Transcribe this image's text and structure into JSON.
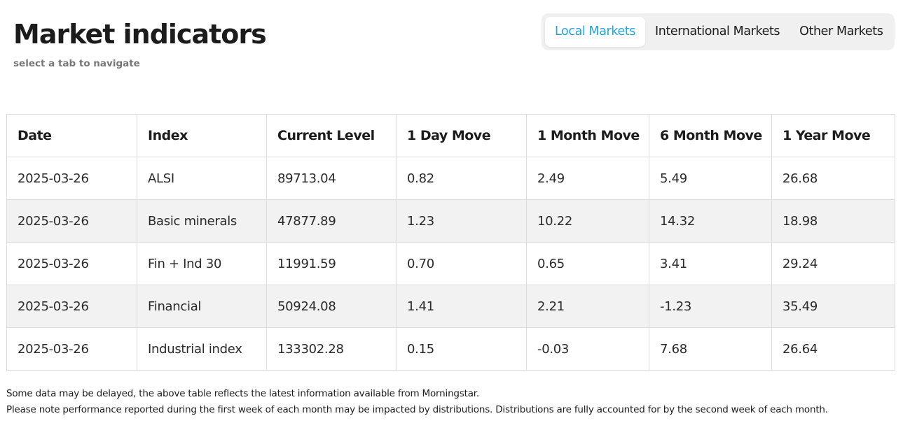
{
  "header": {
    "title": "Market indicators",
    "subtitle": "select a tab to navigate"
  },
  "tabs": [
    {
      "label": "Local Markets",
      "active": true
    },
    {
      "label": "International Markets",
      "active": false
    },
    {
      "label": "Other Markets",
      "active": false
    }
  ],
  "colors": {
    "accent": "#1ea5dc",
    "stripe": "#f2f2f2",
    "border": "#dcdcdc"
  },
  "table": {
    "columns": [
      "Date",
      "Index",
      "Current Level",
      "1 Day Move",
      "1 Month Move",
      "6 Month Move",
      "1 Year Move"
    ],
    "rows": [
      [
        "2025-03-26",
        "ALSI",
        "89713.04",
        "0.82",
        "2.49",
        "5.49",
        "26.68"
      ],
      [
        "2025-03-26",
        "Basic minerals",
        "47877.89",
        "1.23",
        "10.22",
        "14.32",
        "18.98"
      ],
      [
        "2025-03-26",
        "Fin + Ind 30",
        "11991.59",
        "0.70",
        "0.65",
        "3.41",
        "29.24"
      ],
      [
        "2025-03-26",
        "Financial",
        "50924.08",
        "1.41",
        "2.21",
        "-1.23",
        "35.49"
      ],
      [
        "2025-03-26",
        "Industrial index",
        "133302.28",
        "0.15",
        "-0.03",
        "7.68",
        "26.64"
      ]
    ]
  },
  "notes": [
    "Some data may be delayed, the above table reflects the latest information available from Morningstar.",
    "Please note performance reported during the first week of each month may be impacted by distributions. Distributions are fully accounted for by the second week of each month."
  ]
}
